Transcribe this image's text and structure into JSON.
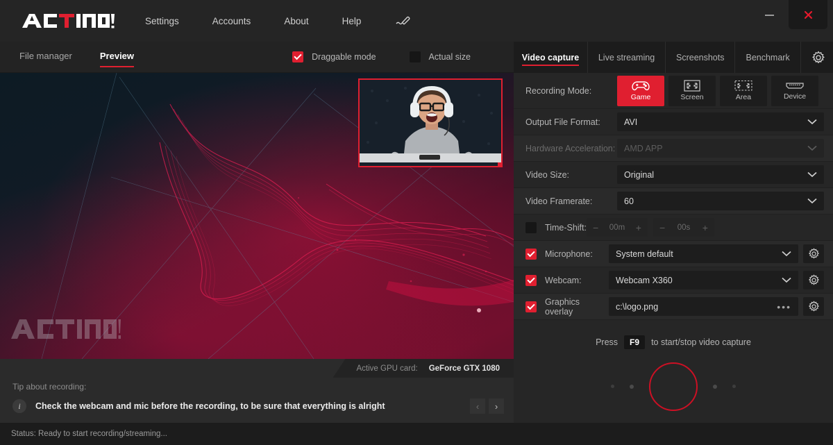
{
  "titlebar": {
    "logo_text": "ACTION!",
    "nav": [
      {
        "label": "Settings",
        "name": "settings"
      },
      {
        "label": "Accounts",
        "name": "accounts"
      },
      {
        "label": "About",
        "name": "about"
      },
      {
        "label": "Help",
        "name": "help"
      }
    ],
    "pen_icon": "pen-icon",
    "minimize_icon": "minimize-icon",
    "close_icon": "close-icon"
  },
  "left": {
    "tabs": {
      "file_manager": "File manager",
      "preview": "Preview"
    },
    "checkboxes": {
      "draggable_label": "Draggable mode",
      "draggable_checked": true,
      "actual_size_label": "Actual size",
      "actual_size_checked": false
    },
    "preview": {
      "watermark": "ACTION!",
      "webcam_overlay_name": "webcam-overlay"
    },
    "gpu": {
      "label": "Active GPU card:",
      "value": "GeForce GTX 1080"
    },
    "tip": {
      "title": "Tip about recording:",
      "text": "Check the webcam and mic before the recording, to be sure that everything is alright",
      "prev": "‹",
      "next": "›"
    },
    "status": "Status: Ready to start recording/streaming..."
  },
  "right": {
    "tabs": [
      {
        "label": "Video capture",
        "active": true
      },
      {
        "label": "Live streaming",
        "active": false
      },
      {
        "label": "Screenshots",
        "active": false
      },
      {
        "label": "Benchmark",
        "active": false
      }
    ],
    "settings_gear_icon": "gear-icon",
    "recording_mode": {
      "label": "Recording Mode:",
      "options": [
        {
          "label": "Game",
          "icon": "gamepad-icon",
          "active": true
        },
        {
          "label": "Screen",
          "icon": "fullscreen-icon",
          "active": false
        },
        {
          "label": "Area",
          "icon": "area-select-icon",
          "active": false
        },
        {
          "label": "Device",
          "icon": "hdmi-device-icon",
          "active": false
        }
      ]
    },
    "output_format": {
      "label": "Output File Format:",
      "value": "AVI"
    },
    "hardware_accel": {
      "label": "Hardware Acceleration:",
      "value": "AMD APP",
      "disabled": true
    },
    "video_size": {
      "label": "Video Size:",
      "value": "Original"
    },
    "video_framerate": {
      "label": "Video Framerate:",
      "value": "60"
    },
    "time_shift": {
      "label": "Time-Shift:",
      "checked": false,
      "minutes": "00m",
      "seconds": "00s",
      "minus": "−",
      "plus": "+"
    },
    "microphone": {
      "label": "Microphone:",
      "checked": true,
      "value": "System default"
    },
    "webcam": {
      "label": "Webcam:",
      "checked": true,
      "value": "Webcam X360"
    },
    "graphics_overlay": {
      "label": "Graphics overlay",
      "checked": true,
      "value": "c:\\logo.png",
      "browse": "•••"
    },
    "press_hint": {
      "prefix": "Press",
      "key": "F9",
      "suffix": "to start/stop video capture"
    },
    "record_button_name": "record-button"
  },
  "colors": {
    "accent_red": "#e01f30",
    "record_ring": "#cc1024",
    "panel_bg": "#262626",
    "dark_bg": "#1c1c1c"
  }
}
